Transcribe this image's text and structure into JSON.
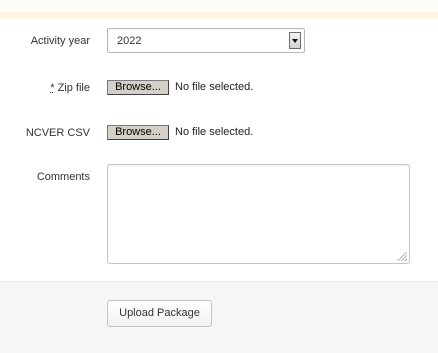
{
  "form": {
    "activity_year": {
      "label": "Activity year",
      "selected": "2022"
    },
    "zip_file": {
      "required_marker": "*",
      "label": " Zip file",
      "button_label": "Browse...",
      "status": "No file selected."
    },
    "ncver_csv": {
      "label": "NCVER CSV",
      "button_label": "Browse...",
      "status": "No file selected."
    },
    "comments": {
      "label": "Comments",
      "value": ""
    }
  },
  "footer": {
    "upload_label": "Upload Package"
  }
}
